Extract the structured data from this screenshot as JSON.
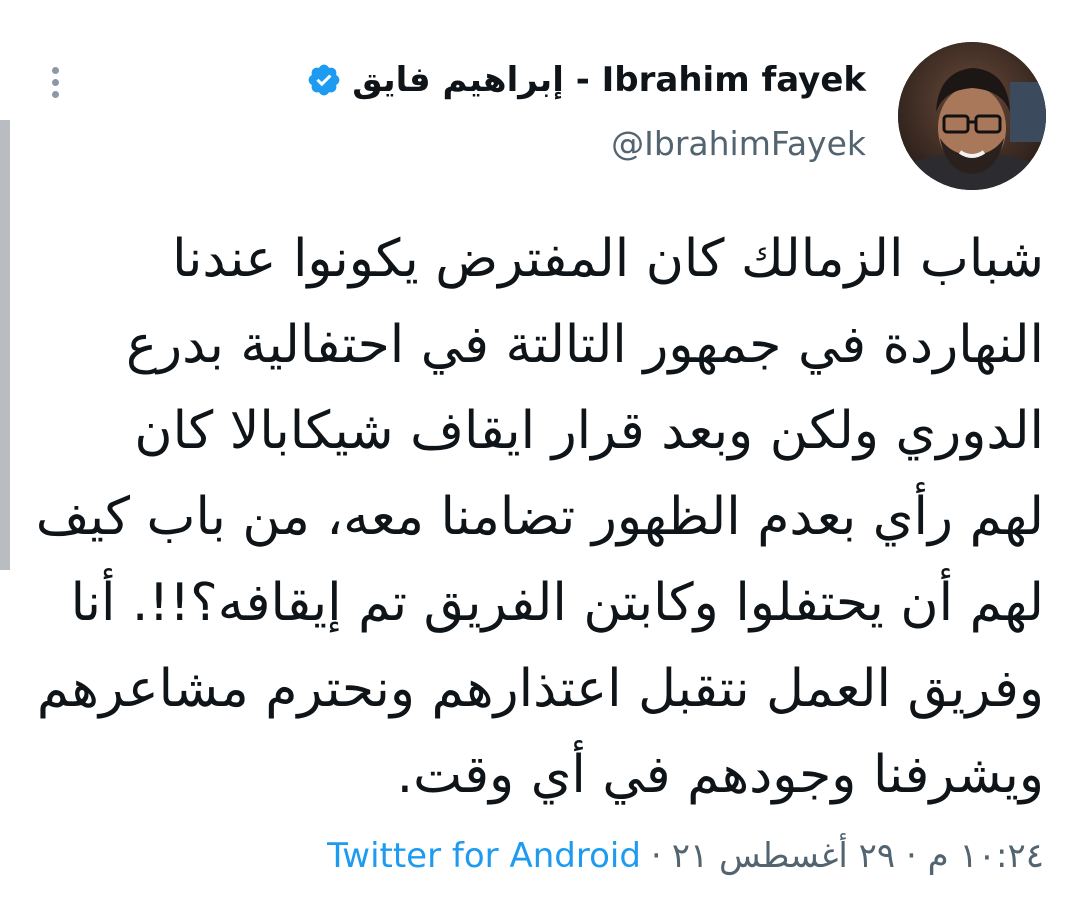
{
  "author": {
    "display_name": "إبراهيم فايق - Ibrahim fayek",
    "handle": "@IbrahimFayek",
    "verified": true
  },
  "tweet": {
    "lines": [
      "شباب الزمالك كان المفترض يكونوا عندنا",
      "النهاردة في جمهور التالتة في احتفالية بدرع",
      "الدوري ولكن وبعد قرار ايقاف شيكابالا كان",
      "لهم رأي بعدم الظهور تضامنا معه، من باب كيف",
      "لهم أن يحتفلوا وكابتن الفريق تم إيقافه؟!!. أنا",
      "وفريق العمل نتقبل اعتذارهم ونحترم مشاعرهم",
      "ويشرفنا وجودهم في أي وقت."
    ]
  },
  "meta": {
    "time_date": "١٠:٢٤ م · ٢٩ أغسطس ٢١",
    "separator": "·",
    "source": "Twitter for Android"
  },
  "icons": {
    "more": "more-vertical-icon",
    "verified": "verified-badge-icon"
  },
  "colors": {
    "text": "#0f1419",
    "secondary": "#536471",
    "accent": "#1d9bf0",
    "scrollbar": "#b9bcc0"
  }
}
